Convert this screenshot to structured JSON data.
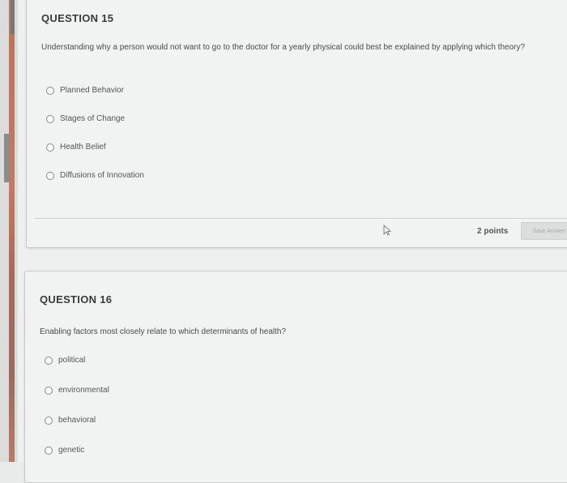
{
  "questions": [
    {
      "title": "QUESTION 15",
      "prompt": "Understanding why a person would not want to go to the doctor for a yearly physical could best be explained by applying which theory?",
      "options": [
        {
          "label": "Planned Behavior",
          "selected": false
        },
        {
          "label": "Stages of Change",
          "selected": false
        },
        {
          "label": "Health Belief",
          "selected": false
        },
        {
          "label": "Diffusions of Innovation",
          "selected": false
        }
      ],
      "points": "2 points",
      "save_label": "Save Answer"
    },
    {
      "title": "QUESTION 16",
      "prompt": "Enabling factors most closely relate to which determinants of health?",
      "options": [
        {
          "label": "political",
          "selected": false
        },
        {
          "label": "environmental",
          "selected": false
        },
        {
          "label": "behavioral",
          "selected": false
        },
        {
          "label": "genetic",
          "selected": false
        }
      ]
    }
  ],
  "icons": {
    "radio": "radio-unselected-icon",
    "cursor": "mouse-pointer-icon"
  },
  "colors": {
    "background": "#eeefef",
    "card": "#f1f2f2",
    "text": "#333333",
    "side_strip": "#b8735f"
  }
}
